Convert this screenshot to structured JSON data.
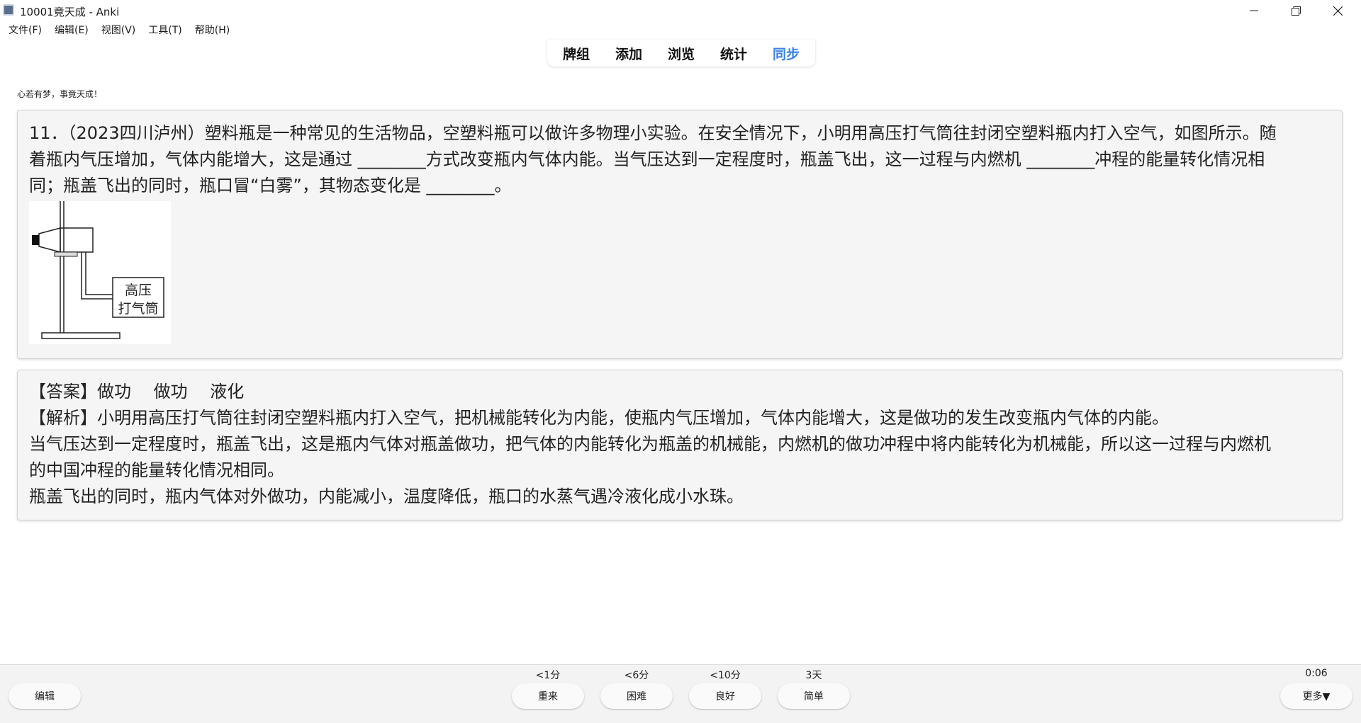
{
  "window": {
    "title": "10001竟天成 - Anki",
    "icon": "anki-app-icon"
  },
  "menu": [
    "文件(F)",
    "编辑(E)",
    "视图(V)",
    "工具(T)",
    "帮助(H)"
  ],
  "tabs": [
    {
      "label": "牌组"
    },
    {
      "label": "添加"
    },
    {
      "label": "浏览"
    },
    {
      "label": "统计"
    },
    {
      "label": "同步",
      "color": "#3b82e0"
    }
  ],
  "motto": "心若有梦，事竟天成！",
  "question": {
    "line1": "11．（2023四川泸州）塑料瓶是一种常见的生活物品，空塑料瓶可以做许多物理小实验。在安全情况下，小明用高压打气筒往封闭空塑料瓶内打入空气，如图所示。随",
    "line2": "着瓶内气压增加，气体内能增大，这是通过 ________方式改变瓶内气体内能。当气压达到一定程度时，瓶盖飞出，这一过程与内燃机 ________冲程的能量转化情况相",
    "line3": "同；瓶盖飞出的同时，瓶口冒“白雾”，其物态变化是 ________。",
    "figure_label_line1": "高压",
    "figure_label_line2": "打气筒"
  },
  "answer": {
    "line1": "【答案】做功　 做功　 液化",
    "line2": "【解析】小明用高压打气筒往封闭空塑料瓶内打入空气，把机械能转化为内能，使瓶内气压增加，气体内能增大，这是做功的发生改变瓶内气体的内能。",
    "line3": "当气压达到一定程度时，瓶盖飞出，这是瓶内气体对瓶盖做功，把气体的内能转化为瓶盖的机械能，内燃机的做功冲程中将内能转化为机械能，所以这一过程与内燃机",
    "line4": "的中国冲程的能量转化情况相同。",
    "line5": "瓶盖飞出的同时，瓶内气体对外做功，内能减小，温度降低，瓶口的水蒸气遇冷液化成小水珠。"
  },
  "bottom": {
    "edit_label": "编辑",
    "more_label": "更多▼",
    "timer": "0:06",
    "answers": [
      {
        "label": "重来",
        "interval": "<1分"
      },
      {
        "label": "困难",
        "interval": "<6分"
      },
      {
        "label": "良好",
        "interval": "<10分"
      },
      {
        "label": "简单",
        "interval": "3天"
      }
    ]
  }
}
